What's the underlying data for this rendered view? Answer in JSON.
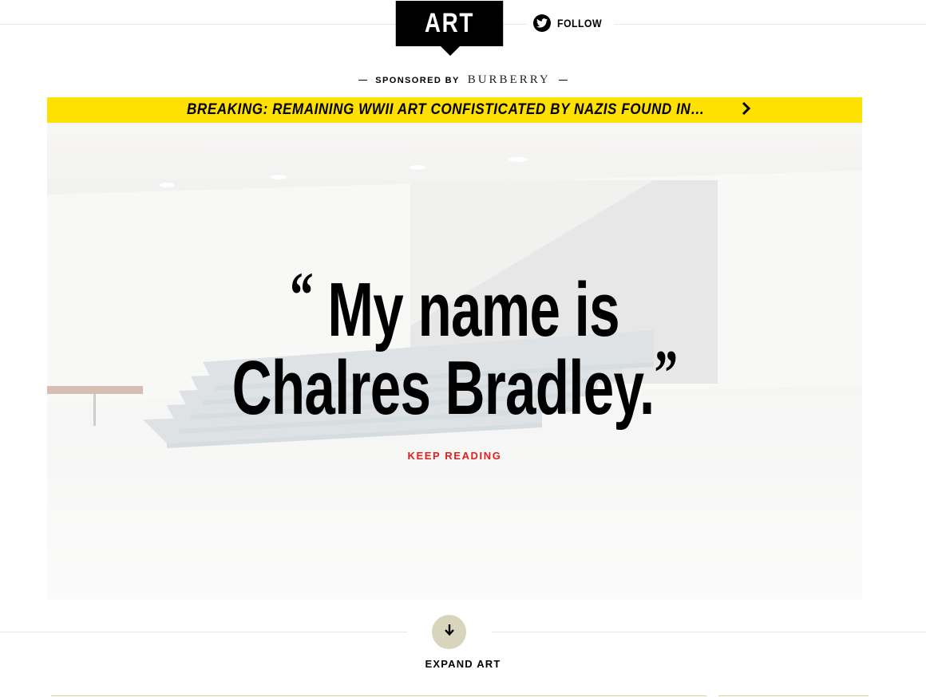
{
  "header": {
    "section_label": "ART",
    "follow_label": "FOLLOW"
  },
  "sponsor": {
    "prefix": "SPONSORED BY",
    "brand": "BURBERRY"
  },
  "breaking": {
    "text": "BREAKING: REMAINING WWII ART CONFISTICATED BY NAZIS FOUND IN…",
    "background": "#ffe100"
  },
  "hero": {
    "quote_line_1": "My name is",
    "quote_line_2": "Chalres Bradley.",
    "open_quote": "“",
    "close_quote": "”",
    "cta": "KEEP READING",
    "cta_color": "#e0201b"
  },
  "expand": {
    "label": "EXPAND ART",
    "icon": "arrow-down-icon",
    "button_color": "#d9d5bd"
  }
}
